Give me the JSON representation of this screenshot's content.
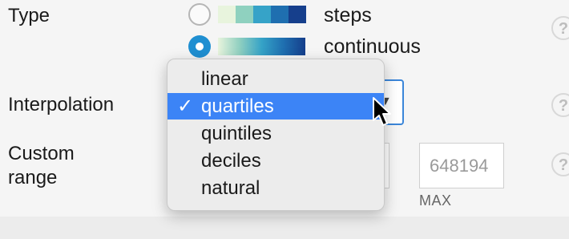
{
  "type_row": {
    "label": "Type",
    "options": [
      {
        "label": "steps",
        "selected": false,
        "swatch_colors": [
          "#e8f4dd",
          "#8fd1bf",
          "#36a3c8",
          "#1f6fb0",
          "#163f8c"
        ]
      },
      {
        "label": "continuous",
        "selected": true
      }
    ],
    "accent": "#1f8fd1"
  },
  "interpolation": {
    "label": "Interpolation",
    "menu_items": [
      {
        "label": "linear",
        "selected": false
      },
      {
        "label": "quartiles",
        "selected": true
      },
      {
        "label": "quintiles",
        "selected": false
      },
      {
        "label": "deciles",
        "selected": false
      },
      {
        "label": "natural",
        "selected": false
      }
    ],
    "check_glyph": "✓",
    "selected_color": "#3c84f6"
  },
  "custom_range": {
    "label_line1": "Custom",
    "label_line2": "range",
    "max_value": "648194",
    "max_label": "MAX"
  },
  "help_glyph": "?",
  "icons": {
    "help": "question-circle-icon",
    "cursor": "arrow-pointer-icon",
    "check": "checkmark-icon"
  }
}
